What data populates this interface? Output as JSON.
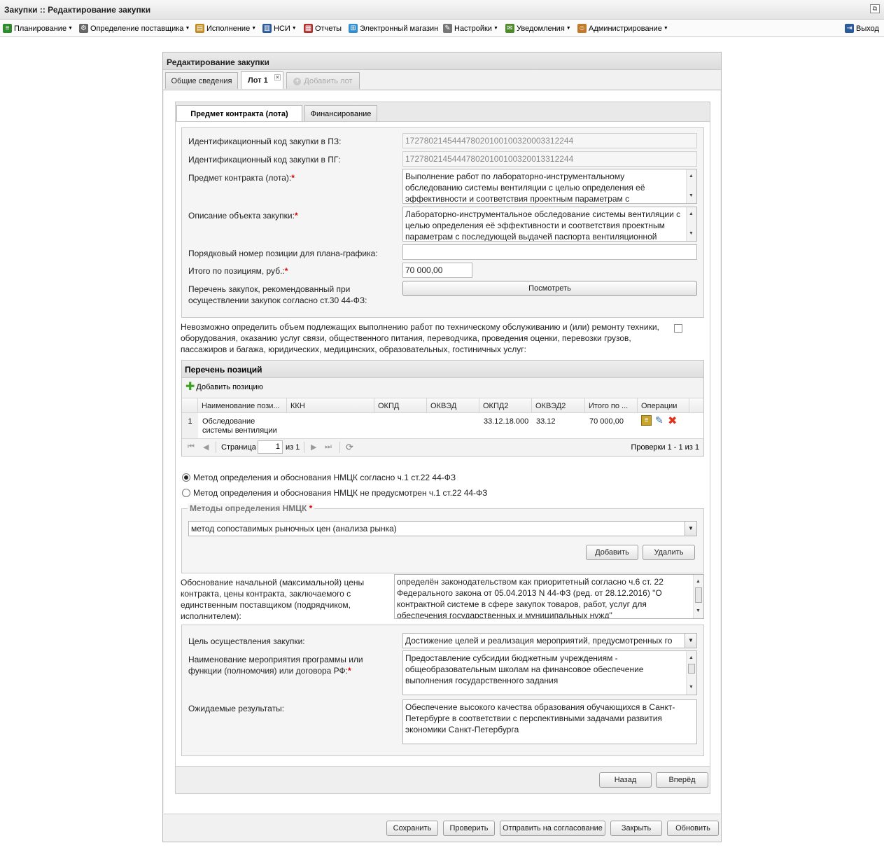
{
  "window": {
    "title": "Закупки :: Редактирование закупки",
    "restore_icon": "restore-icon"
  },
  "menu": [
    {
      "label": "Планирование",
      "icon": "planning-icon",
      "color": "#2e8b2e"
    },
    {
      "label": "Определение поставщика",
      "icon": "gears-icon",
      "color": "#555555"
    },
    {
      "label": "Исполнение",
      "icon": "execution-icon",
      "color": "#c08a1e"
    },
    {
      "label": "НСИ",
      "icon": "book-icon",
      "color": "#2b5a9a"
    },
    {
      "label": "Отчеты",
      "icon": "report-icon",
      "color": "#b03030"
    },
    {
      "label": "Электронный магазин",
      "icon": "cart-icon",
      "color": "#2f8fd0"
    },
    {
      "label": "Настройки",
      "icon": "wrench-icon",
      "color": "#666666"
    },
    {
      "label": "Уведомления",
      "icon": "notification-icon",
      "color": "#4d8a2a"
    },
    {
      "label": "Администрирование",
      "icon": "user-icon",
      "color": "#c07a2a"
    }
  ],
  "logout": {
    "label": "Выход"
  },
  "form": {
    "title": "Редактирование закупки",
    "tabs": {
      "general": "Общие сведения",
      "lot1": "Лот 1",
      "add_lot": "Добавить лот"
    },
    "inner_tabs": {
      "subject": "Предмет контракта (лота)",
      "financing": "Финансирование"
    }
  },
  "fields": {
    "pz_code_label": "Идентификационный код закупки в ПЗ:",
    "pz_code_value": "172780214544478020100100320003312244",
    "pg_code_label": "Идентификационный код закупки в ПГ:",
    "pg_code_value": "172780214544478020100100320013312244",
    "subject_label": "Предмет контракта (лота):",
    "subject_value": "Выполнение работ по лабораторно-инструментальному обследованию системы вентиляции с целью определения её эффективности и соответствия проектным параметрам с",
    "description_label": "Описание объекта закупки:",
    "description_value": "Лабораторно-инструментальное обследование системы вентиляции с целью определения её эффективности и соответствия проектным параметрам с последующей выдачей паспорта вентиляционной",
    "position_number_label": "Порядковый номер позиции для плана-графика:",
    "position_number_value": "",
    "total_label": "Итого по позициям, руб.:",
    "total_value": "70 000,00",
    "recommended_list_label": "Перечень закупок, рекомендованный при осуществлении закупок согласно ст.30 44-ФЗ:",
    "view_button": "Посмотреть"
  },
  "impossible_volume": {
    "label": "Невозможно определить объем подлежащих выполнению работ по техническому обслуживанию и (или) ремонту техники, оборудования, оказанию услуг связи, общественного питания, переводчика, проведения оценки, перевозки грузов, пассажиров и багажа, юридических, медицинских, образовательных, гостиничных услуг:",
    "checked": false
  },
  "positions": {
    "title": "Перечень позиций",
    "add_label": "Добавить позицию",
    "columns": [
      "Наименование пози...",
      "ККН",
      "ОКПД",
      "ОКВЭД",
      "ОКПД2",
      "ОКВЭД2",
      "Итого по ...",
      "Операции"
    ],
    "rows": [
      {
        "num": "1",
        "name": "Обследование системы вентиляции",
        "kkn": "",
        "okpd": "",
        "okved": "",
        "okpd2": "33.12.18.000",
        "okved2": "33.12",
        "total": "70 000,00"
      }
    ],
    "pager": {
      "page_label": "Страница",
      "page_value": "1",
      "of_label": "из 1",
      "summary": "Проверки 1 - 1 из 1"
    }
  },
  "nmck": {
    "radio1": "Метод определения и обоснования НМЦК согласно ч.1 ст.22 44-ФЗ",
    "radio2": "Метод определения и обоснования НМЦК не предусмотрен ч.1 ст.22 44-ФЗ",
    "selected": 1,
    "methods_legend": "Методы определения НМЦК",
    "method_value": "метод сопоставимых рыночных цен (анализа рынка)",
    "add_button": "Добавить",
    "delete_button": "Удалить"
  },
  "justification": {
    "label": "Обоснование начальной (максимальной) цены контракта, цены контракта, заключаемого с единственным поставщиком (подрядчиком, исполнителем):",
    "value": "определён законодательством как приоритетный согласно ч.6 ст. 22 Федерального закона от 05.04.2013 N 44-ФЗ (ред. от 28.12.2016) \"О контрактной системе в сфере закупок товаров, работ, услуг для обеспечения государственных и муниципальных нужд\""
  },
  "goals": {
    "purpose_label": "Цель осуществления закупки:",
    "purpose_value": "Достижение целей и реализация мероприятий, предусмотренных го",
    "event_label": "Наименование мероприятия программы или функции (полномочия) или договора РФ:",
    "event_value": "Предоставление субсидии бюджетным учреждениям - общеобразовательным школам на финансовое обеспечение выполнения государственного задания",
    "results_label": "Ожидаемые результаты:",
    "results_value": "Обеспечение высокого качества образования обучающихся в Санкт-Петербурге в соответствии с перспективными задачами развития экономики Санкт-Петербурга"
  },
  "nav": {
    "back": "Назад",
    "forward": "Вперёд"
  },
  "footer": {
    "save": "Сохранить",
    "check": "Проверить",
    "send": "Отправить на согласование",
    "close": "Закрыть",
    "refresh": "Обновить"
  }
}
